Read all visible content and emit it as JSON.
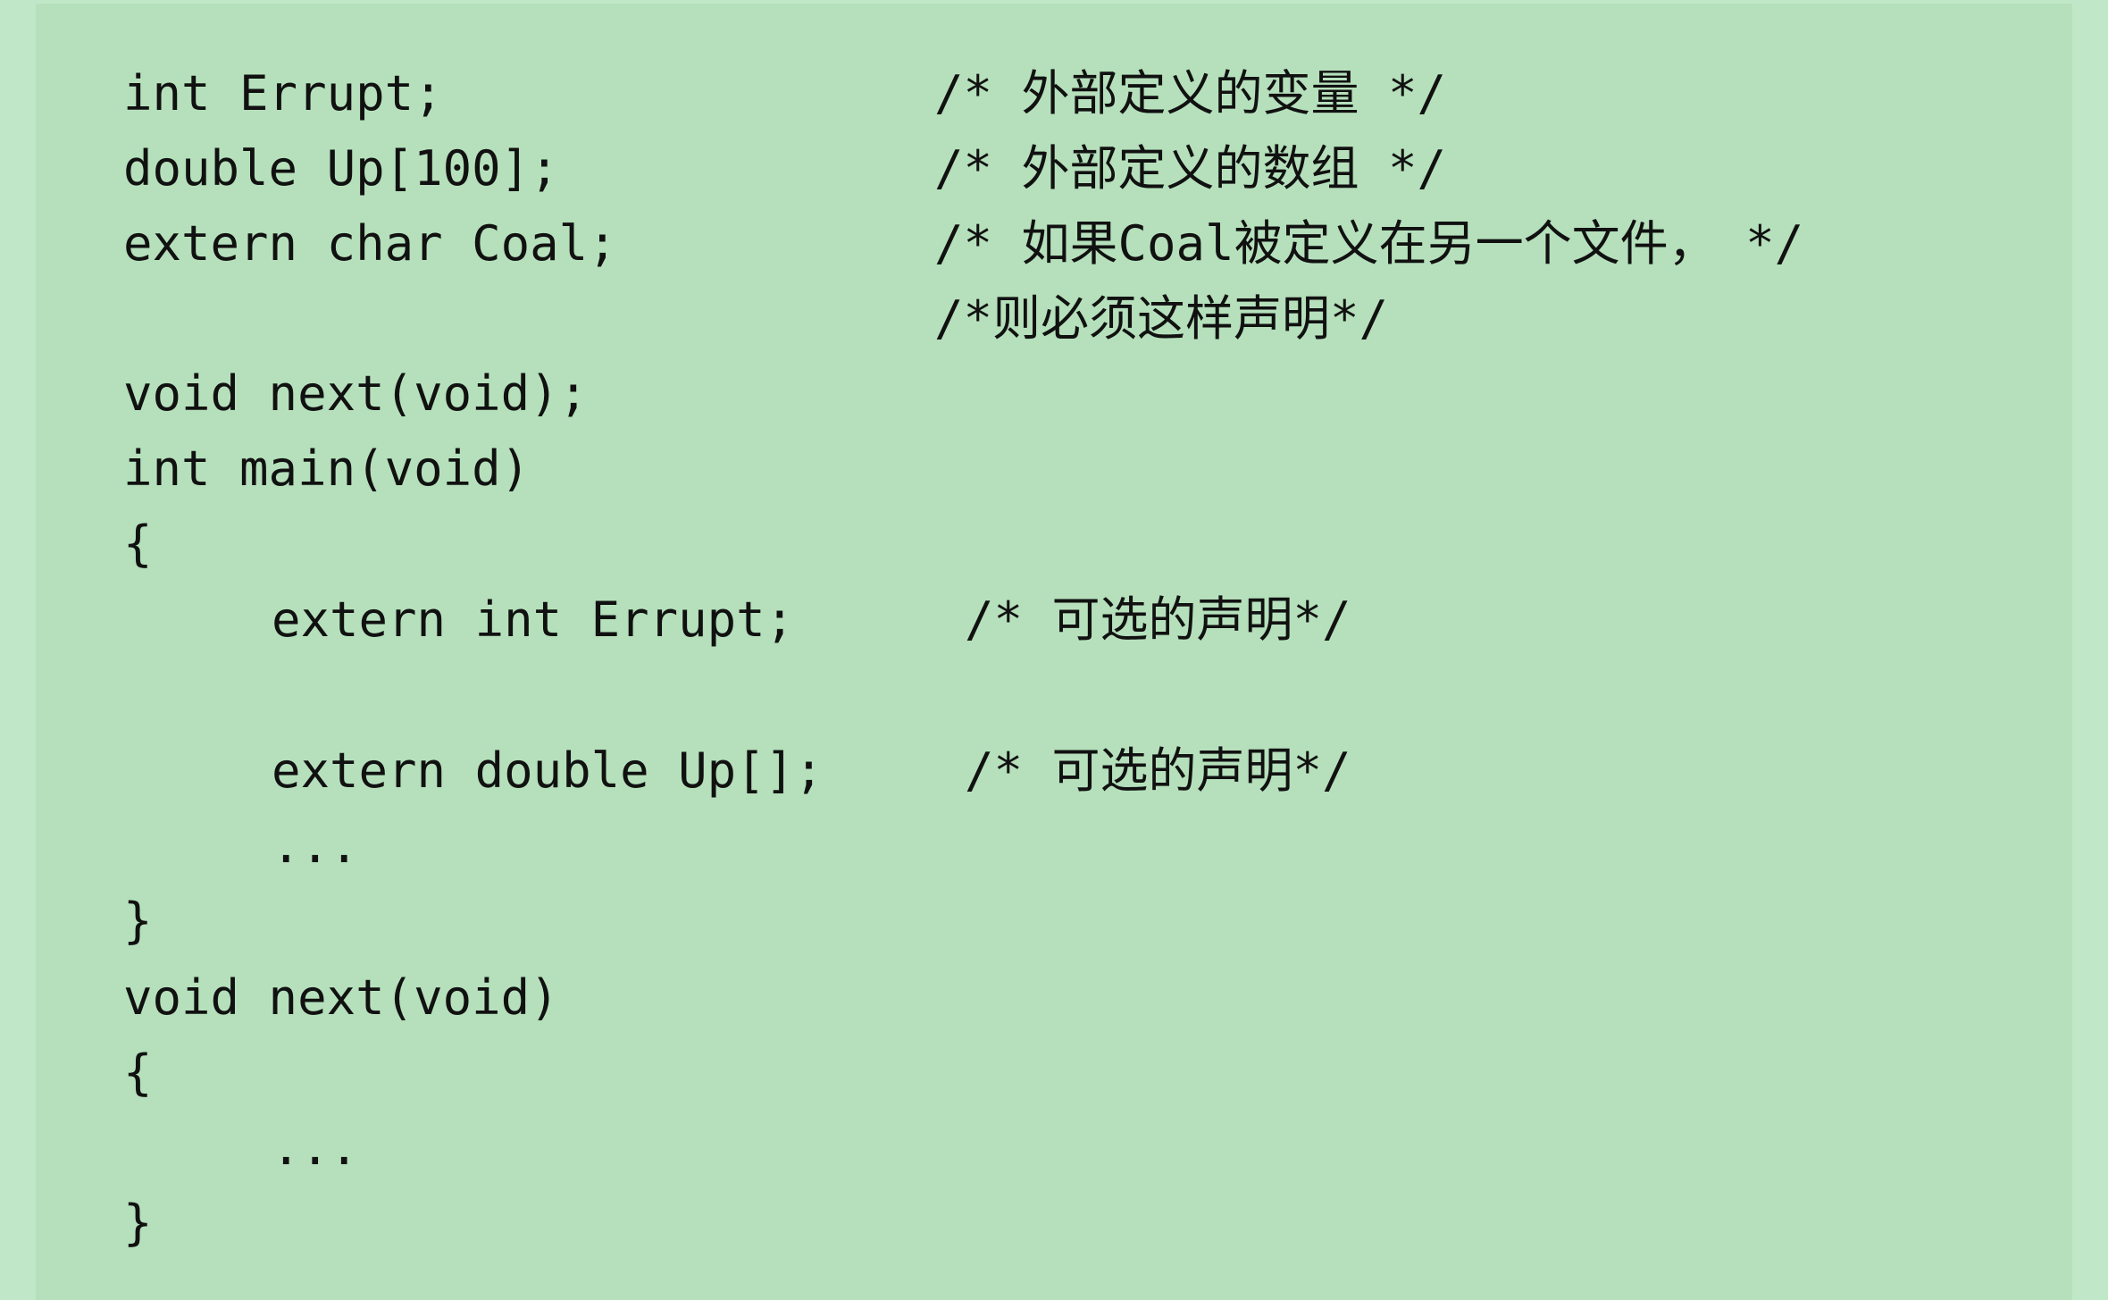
{
  "code": {
    "lines": [
      "int Errupt;",
      "double Up[100];",
      "extern char Coal;",
      "void next(void);",
      "int main(void)",
      "{",
      "extern int Errupt;",
      "extern double Up[];",
      "...",
      "}",
      "void next(void)",
      "{",
      "...",
      "}"
    ],
    "comments": [
      "/* 外部定义的变量 */",
      "/* 外部定义的数组 */",
      "/* 如果Coal被定义在另一个文件， */",
      "/*则必须这样声明*/",
      "/* 可选的声明*/",
      "/* 可选的声明*/"
    ]
  },
  "colors": {
    "page_background": "#c0e8c8",
    "panel_background": "#b5e0bb",
    "text": "#111111"
  }
}
